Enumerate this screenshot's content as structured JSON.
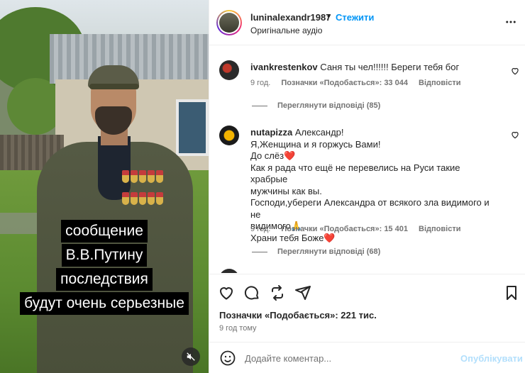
{
  "video": {
    "caption_lines": [
      "сообщение",
      "В.В.Путину",
      "последствия",
      "будут очень серьезные"
    ],
    "mute_icon": "muted-speaker-icon"
  },
  "header": {
    "username": "luninalexandr1987",
    "separator": "•",
    "follow_label": "Стежити",
    "audio_label": "Оригінальне аудіо",
    "more_icon": "more-options-icon"
  },
  "comments": [
    {
      "user": "ivankrestenkov",
      "text": "Саня ты чел!!!!!! Береги тебя бог",
      "time": "9 год.",
      "likes": "Позначки «Подобається»: 33 044",
      "reply_label": "Відповісти",
      "view_replies": "Переглянути відповіді (85)"
    },
    {
      "user": "nutapizza",
      "lines": [
        "Александр!",
        "Я,Женщина и я горжусь Вами!",
        "До слёз❤️",
        "Как я рада что ещё не перевелись на Руси такие храбрые",
        "мужчины как вы.",
        "Господи,убереги Александра от всякого зла видимого и не",
        "видимого🙏",
        "Храни тебя Боже❤️"
      ],
      "time": "9 год.",
      "likes": "Позначки «Подобається»: 15 401",
      "reply_label": "Відповісти",
      "view_replies": "Переглянути відповіді (68)"
    }
  ],
  "actions": {
    "likes_text": "Позначки «Подобається»: 221 тис.",
    "time_ago": "9 год тому"
  },
  "add_comment": {
    "placeholder": "Додайте коментар...",
    "publish_label": "Опублікувати"
  },
  "colors": {
    "accent": "#0095f6",
    "publish_disabled": "#b2dffc",
    "secondary_text": "#737373"
  }
}
